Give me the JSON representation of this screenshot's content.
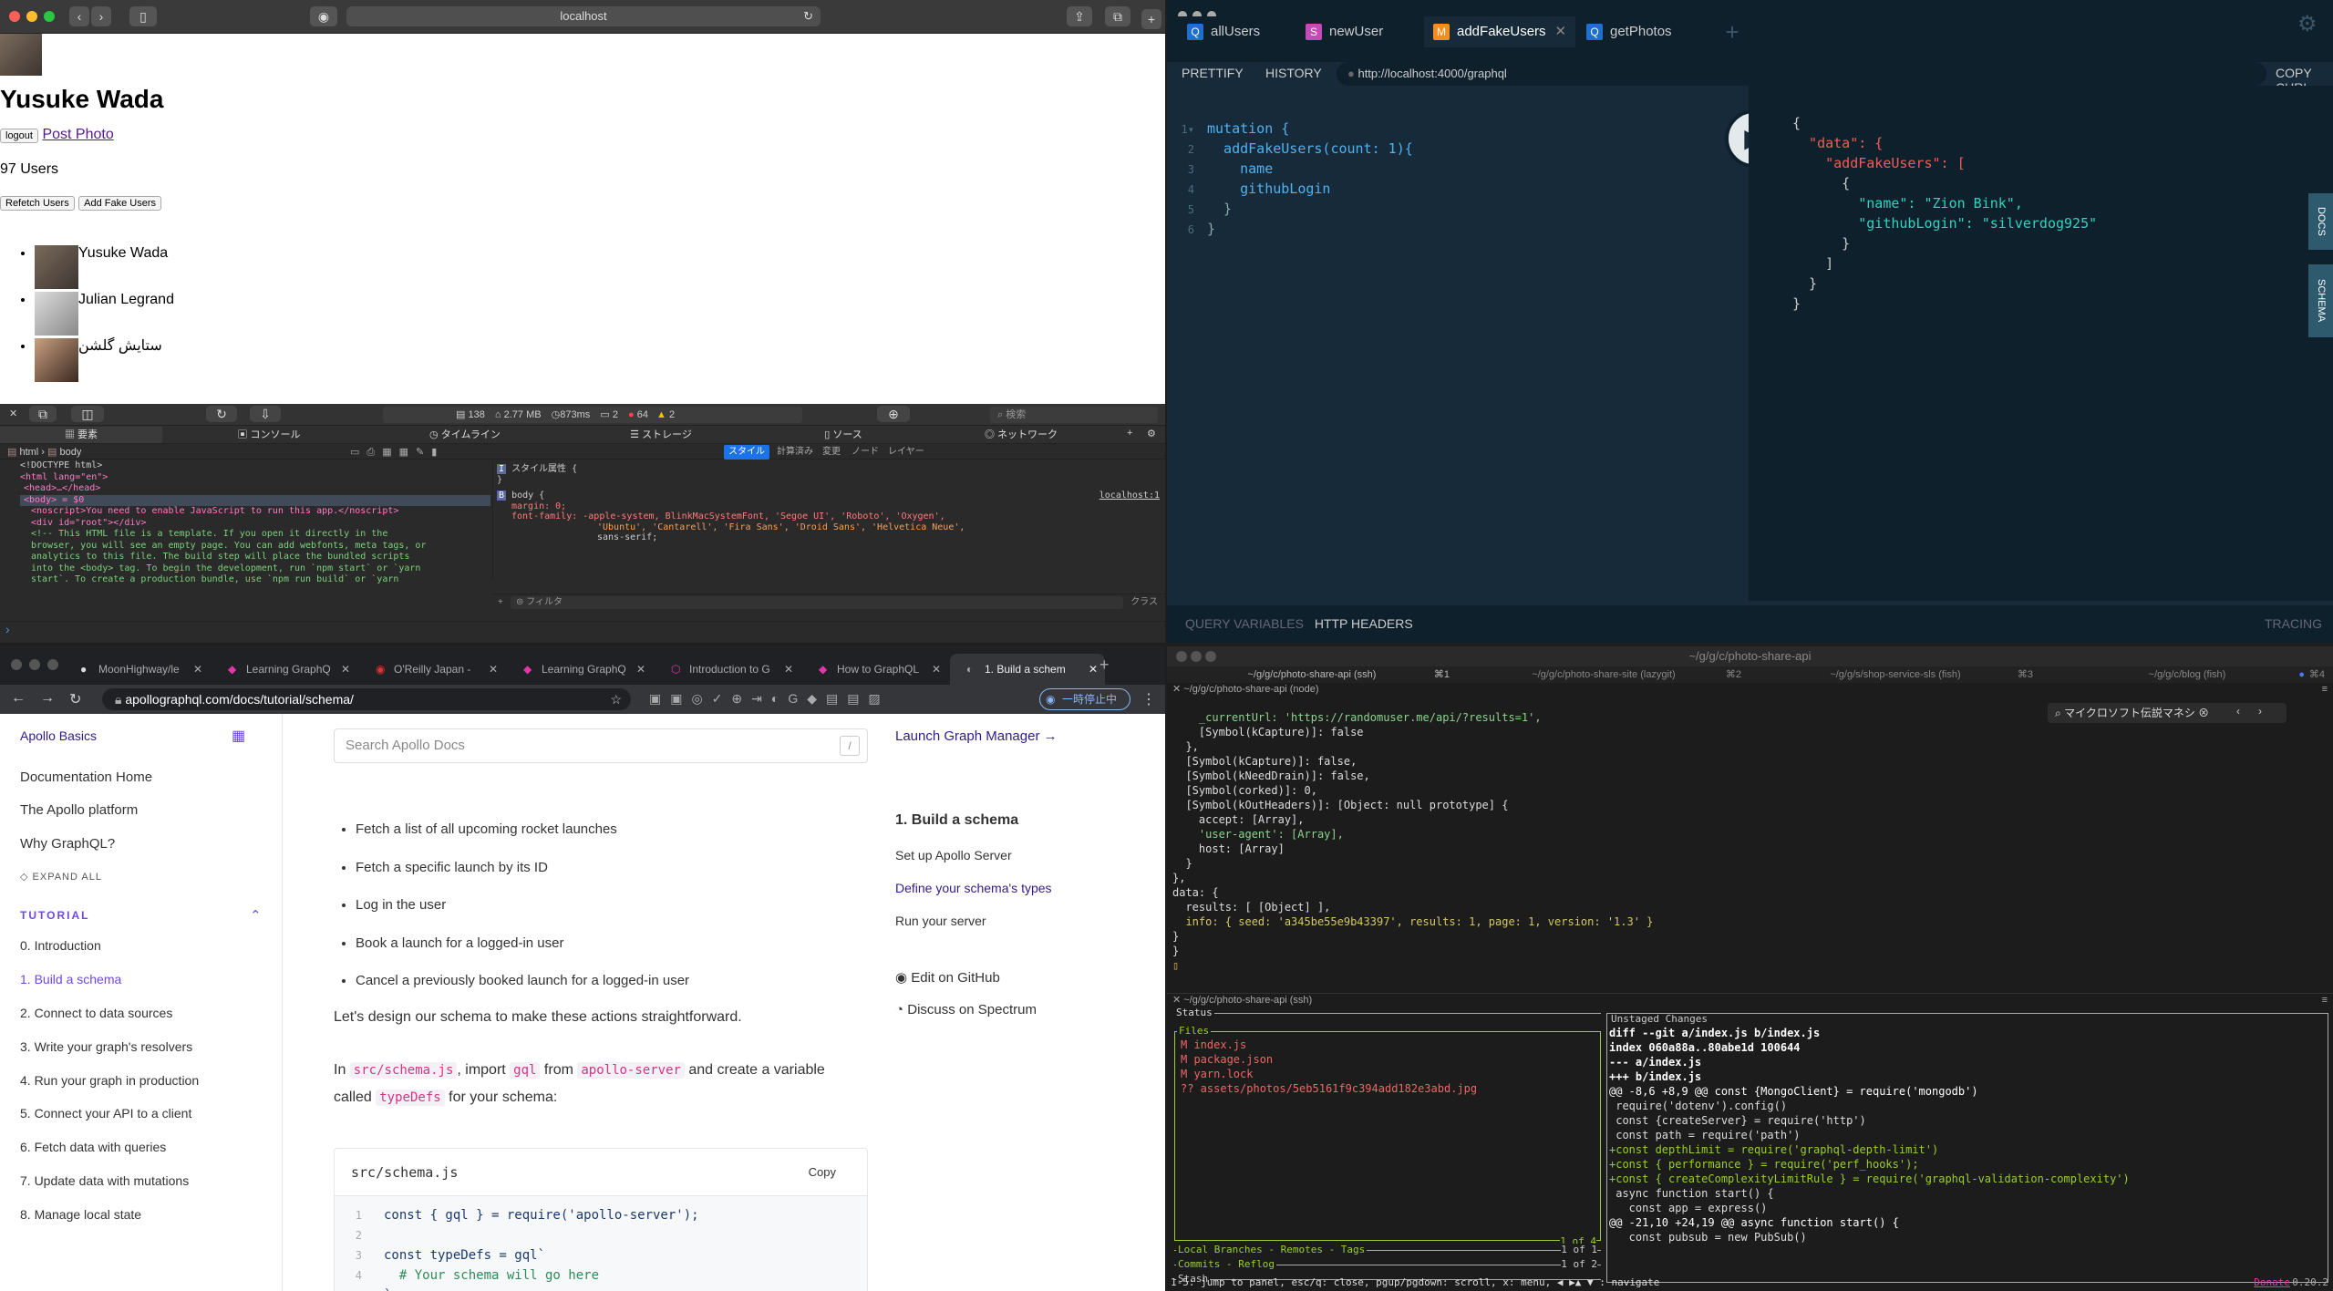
{
  "safari": {
    "url": "localhost",
    "profile_name": "Yusuke Wada",
    "logout_label": "logout",
    "post_photo_label": "Post Photo",
    "user_count": "97 Users",
    "refetch_label": "Refetch Users",
    "add_fake_label": "Add Fake Users",
    "users": [
      "Yusuke Wada",
      "Julian Legrand",
      "ستایش گلشن"
    ]
  },
  "devtools": {
    "stats": {
      "requests": "138",
      "size": "2.77 MB",
      "time": "873ms",
      "messages": "2",
      "errors": "64",
      "warnings": "2"
    },
    "search_placeholder": "検索",
    "tabs": [
      "要素",
      "コンソール",
      "タイムライン",
      "ストレージ",
      "ソース",
      "ネットワーク"
    ],
    "breadcrumb": [
      "html",
      "body"
    ],
    "style_tabs": [
      "スタイル",
      "計算済み",
      "変更",
      "ノード",
      "レイヤー"
    ],
    "dom_lines": [
      "<!DOCTYPE html>",
      "<html lang=\"en\">",
      "<head>…</head>",
      "<body> = $0",
      "<noscript>You need to enable JavaScript to run this app.</noscript>",
      "<div id=\"root\"></div>",
      "<!-- This HTML file is a template. If you open it directly in the",
      "browser, you will see an empty page. You can add webfonts, meta tags, or",
      "analytics to this file. The build step will place the bundled scripts",
      "into the <body> tag. To begin the development, run `npm start` or `yarn",
      "start`. To create a production bundle, use `npm run build` or `yarn"
    ],
    "style_attr": "スタイル属性 {",
    "body_rule": "body {",
    "source": "localhost:1",
    "rule_lines": [
      "margin: 0;",
      "font-family: -apple-system, BlinkMacSystemFont, 'Segoe UI', 'Roboto', 'Oxygen',",
      "'Ubuntu', 'Cantarell', 'Fira Sans', 'Droid Sans', 'Helvetica Neue',",
      "sans-serif;"
    ],
    "filter_placeholder": "フィルタ",
    "class_label": "クラス"
  },
  "gql": {
    "tabs": [
      {
        "tag": "Q",
        "label": "allUsers",
        "color": "#1f6fd1"
      },
      {
        "tag": "S",
        "label": "newUser",
        "color": "#c24bb5"
      },
      {
        "tag": "M",
        "label": "addFakeUsers",
        "color": "#f58d20"
      },
      {
        "tag": "Q",
        "label": "getPhotos",
        "color": "#1f6fd1"
      }
    ],
    "prettify": "PRETTIFY",
    "history": "HISTORY",
    "endpoint": "http://localhost:4000/graphql",
    "copy_curl": "COPY CURL",
    "query_lines": [
      "mutation {",
      "  addFakeUsers(count: 1){",
      "    name",
      "    githubLogin",
      "  }",
      "}"
    ],
    "result_lines": [
      "{",
      "  \"data\": {",
      "    \"addFakeUsers\": [",
      "      {",
      "        \"name\": \"Zion Bink\",",
      "        \"githubLogin\": \"silverdog925\"",
      "      }",
      "    ]",
      "  }",
      "}"
    ],
    "docs": "DOCS",
    "schema": "SCHEMA",
    "query_variables": "QUERY VARIABLES",
    "http_headers": "HTTP HEADERS",
    "tracing": "TRACING"
  },
  "chrome": {
    "tabs": [
      "MoonHighway/le",
      "Learning GraphQ",
      "O'Reilly Japan -",
      "Learning GraphQ",
      "Introduction to G",
      "How to GraphQL",
      "1. Build a schem"
    ],
    "url": "apollographql.com/docs/tutorial/schema/",
    "paused_label": "一時停止中",
    "sidebar": {
      "brand": "Apollo Basics",
      "links": [
        "Documentation Home",
        "The Apollo platform",
        "Why GraphQL?"
      ],
      "expand_all": "EXPAND ALL",
      "section": "TUTORIAL",
      "items": [
        "0. Introduction",
        "1. Build a schema",
        "2. Connect to data sources",
        "3. Write your graph's resolvers",
        "4. Run your graph in production",
        "5. Connect your API to a client",
        "6. Fetch data with queries",
        "7. Update data with mutations",
        "8. Manage local state"
      ]
    },
    "search_placeholder": "Search Apollo Docs",
    "search_key": "/",
    "bullets": [
      "Fetch a list of all upcoming rocket launches",
      "Fetch a specific launch by its ID",
      "Log in the user",
      "Book a launch for a logged-in user",
      "Cancel a previously booked launch for a logged-in user"
    ],
    "para1": "Let's design our schema to make these actions straightforward.",
    "para2_parts": [
      "In ",
      "src/schema.js",
      ", import ",
      "gql",
      " from ",
      "apollo-server",
      " and create a variable called ",
      "typeDefs",
      " for your schema:"
    ],
    "code_file": "src/schema.js",
    "copy": "Copy",
    "code_lines": [
      "const { gql } = require('apollo-server');",
      "",
      "const typeDefs = gql`",
      "  # Your schema will go here",
      "`;"
    ],
    "launch_graph_manager": "Launch Graph Manager →",
    "toc_title": "1. Build a schema",
    "toc": [
      "Set up Apollo Server",
      "Define your schema's types",
      "Run your server"
    ],
    "edit_github": "Edit on GitHub",
    "discuss": "Discuss on Spectrum"
  },
  "terminal": {
    "title": "~/g/g/c/photo-share-api",
    "tabs": [
      "~/g/g/c/photo-share-api (ssh)",
      "~/g/g/c/photo-share-site (lazygit)",
      "~/g/g/s/shop-service-sls (fish)",
      "~/g/g/c/blog (fish)"
    ],
    "tab_keys": [
      "⌘1",
      "⌘2",
      "⌘3",
      "⌘4"
    ],
    "pane1_title": "~/g/g/c/photo-share-api (node)",
    "find_text": "マイクロソフト伝説マネシ",
    "node_lines": [
      "    _currentUrl: 'https://randomuser.me/api/?results=1',",
      "    [Symbol(kCapture)]: false",
      "  },",
      "  [Symbol(kCapture)]: false,",
      "  [Symbol(kNeedDrain)]: false,",
      "  [Symbol(corked)]: 0,",
      "  [Symbol(kOutHeaders)]: [Object: null prototype] {",
      "    accept: [Array],",
      "    'user-agent': [Array],",
      "    host: [Array]",
      "  }",
      "},",
      "data: {",
      "  results: [ [Object] ],",
      "  info: { seed: 'a345be55e9b43397', results: 1, page: 1, version: '1.3' }",
      "}",
      "}"
    ],
    "pane2_title": "~/g/g/c/photo-share-api (ssh)",
    "status_label": "Status",
    "files_label": "Files",
    "files": [
      "M index.js",
      "M package.json",
      "M yarn.lock",
      "?? assets/photos/5eb5161f9c394add182e3abd.jpg"
    ],
    "files_count": "1 of 4",
    "branches_label": "Local Branches - Remotes - Tags",
    "branches_count": "1 of 1",
    "commits_label": "Commits - Reflog",
    "commits_count": "1 of 2",
    "stash_label": "Stash",
    "unstaged_label": "Unstaged Changes",
    "diff_lines": [
      "diff --git a/index.js b/index.js",
      "index 060a88a..80abe1d 100644",
      "--- a/index.js",
      "+++ b/index.js",
      "@@ -8,6 +8,9 @@ const {MongoClient} = require('mongodb')",
      " require('dotenv').config()",
      " const {createServer} = require('http')",
      " const path = require('path')",
      "+const depthLimit = require('graphql-depth-limit')",
      "+const { performance } = require('perf_hooks');",
      "+const { createComplexityLimitRule } = require('graphql-validation-complexity')",
      "",
      " async function start() {",
      "   const app = express()",
      "@@ -21,10 +24,19 @@ async function start() {",
      "   const pubsub = new PubSub()"
    ],
    "help": "1-5: jump to panel, esc/q: close, pgup/pgdown: scroll, x: menu, ◀ ▶▲ ▼ : navigate",
    "donate": "Donate",
    "version": "0.20.2"
  }
}
